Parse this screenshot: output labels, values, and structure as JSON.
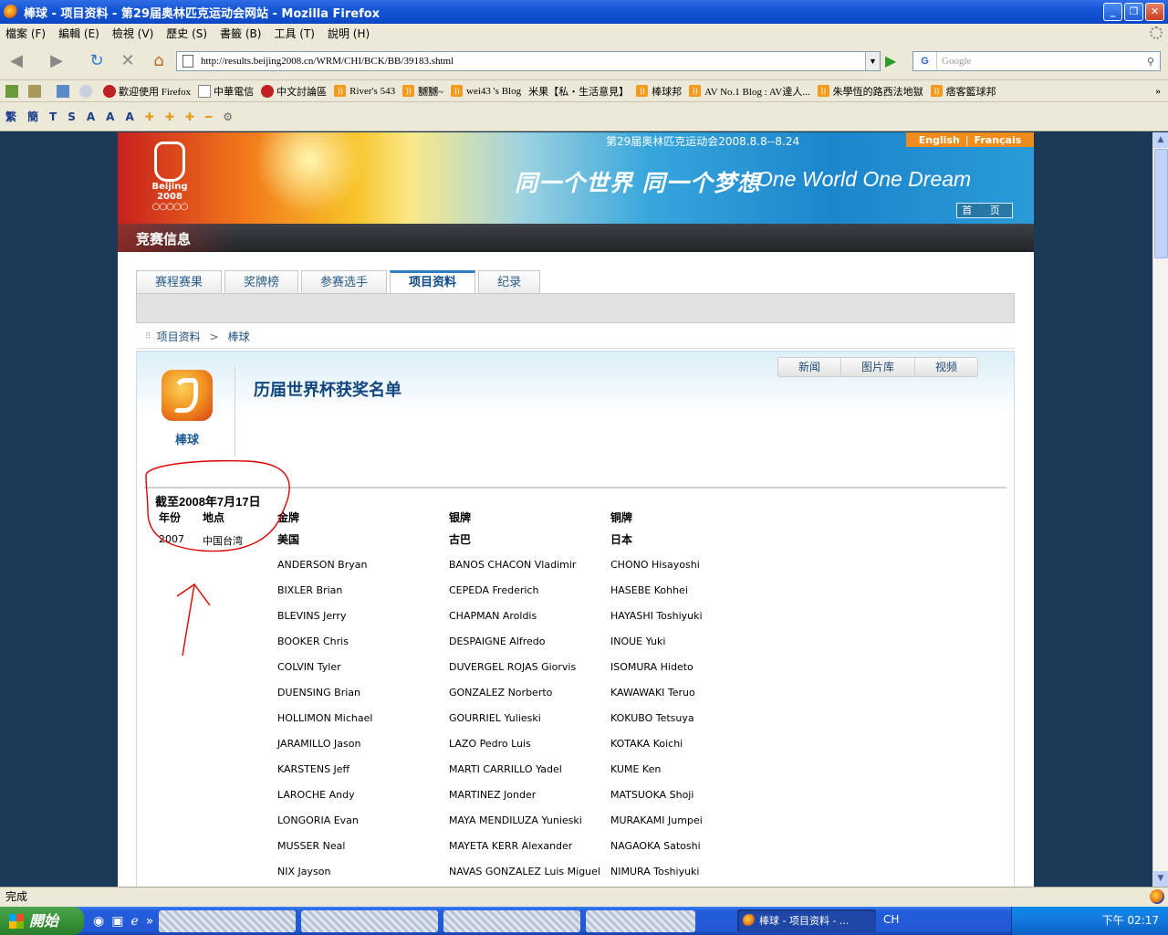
{
  "window": {
    "title": "棒球 - 项目资料 - 第29届奥林匹克运动会网站 - Mozilla Firefox"
  },
  "menu": [
    "檔案 (F)",
    "編輯 (E)",
    "檢視 (V)",
    "歷史 (S)",
    "書籤 (B)",
    "工具 (T)",
    "說明 (H)"
  ],
  "nav": {
    "url": "http://results.beijing2008.cn/WRM/CHI/BCK/BB/39183.shtml",
    "search_placeholder": "Google",
    "search_engine": "G"
  },
  "bookmarks": [
    "歡迎使用 Firefox",
    "中華電信",
    "中文討論區",
    "River's 543",
    "嬲嬲~",
    "wei43 's Blog",
    "米果【私・生活意見】",
    "棒球邦",
    "AV No.1 Blog : AV達人...",
    "朱學恆的路西法地獄",
    "痞客籃球邦"
  ],
  "bookmarks_more": "»",
  "toolbar3": [
    "繁",
    "簡",
    "T",
    "S",
    "A",
    "A",
    "A"
  ],
  "banner": {
    "date": "第29届奥林匹克运动会2008.8.8--8.24",
    "lang_en": "English",
    "lang_sep": "|",
    "lang_fr": "Français",
    "slogan_cn": "同一个世界  同一个梦想",
    "slogan_en": "One World One Dream",
    "home": "首 页",
    "logo_text": "Beijing 2008"
  },
  "section": "竞赛信息",
  "tabs": [
    "赛程赛果",
    "奖牌榜",
    "参赛选手",
    "项目资料",
    "纪录"
  ],
  "active_tab": "项目资料",
  "breadcrumb": {
    "item1": "项目资料",
    "sep": ">",
    "item2": "棒球"
  },
  "media_tabs": [
    "新闻",
    "图片库",
    "视频"
  ],
  "sport": "棒球",
  "page_title": "历届世界杯获奖名单",
  "results": {
    "as_of": "截至2008年7月17日",
    "headers": {
      "year": "年份",
      "venue": "地点",
      "gold": "金牌",
      "silver": "银牌",
      "bronze": "铜牌"
    },
    "year": "2007",
    "venue": "中国台湾",
    "countries": {
      "gold": "美国",
      "silver": "古巴",
      "bronze": "日本"
    },
    "gold": [
      "ANDERSON Bryan",
      "BIXLER Brian",
      "BLEVINS Jerry",
      "BOOKER Chris",
      "COLVIN Tyler",
      "DUENSING Brian",
      "HOLLIMON Michael",
      "JARAMILLO Jason",
      "KARSTENS Jeff",
      "LAROCHE Andy",
      "LONGORIA Evan",
      "MUSSER Neal",
      "NIX Jayson"
    ],
    "silver": [
      "BANOS CHACON Vladimir",
      "CEPEDA Frederich",
      "CHAPMAN Aroldis",
      "DESPAIGNE Alfredo",
      "DUVERGEL ROJAS Giorvis",
      "GONZALEZ Norberto",
      "GOURRIEL Yulieski",
      "LAZO Pedro Luis",
      "MARTI CARRILLO Yadel",
      "MARTINEZ Jonder",
      "MAYA MENDILUZA Yunieski",
      "MAYETA KERR Alexander",
      "NAVAS GONZALEZ Luis Miguel"
    ],
    "bronze": [
      "CHONO Hisayoshi",
      "HASEBE Kohhei",
      "HAYASHI Toshiyuki",
      "INOUE Yuki",
      "ISOMURA Hideto",
      "KAWAWAKI Teruo",
      "KOKUBO Tetsuya",
      "KOTAKA Koichi",
      "KUME Ken",
      "MATSUOKA Shoji",
      "MURAKAMI Jumpei",
      "NAGAOKA Satoshi",
      "NIMURA Toshiyuki"
    ]
  },
  "status": "完成",
  "taskbar": {
    "start": "開始",
    "active_task": "棒球 - 项目资料 - ...",
    "lang": "CH",
    "clock": "下午 02:17"
  }
}
